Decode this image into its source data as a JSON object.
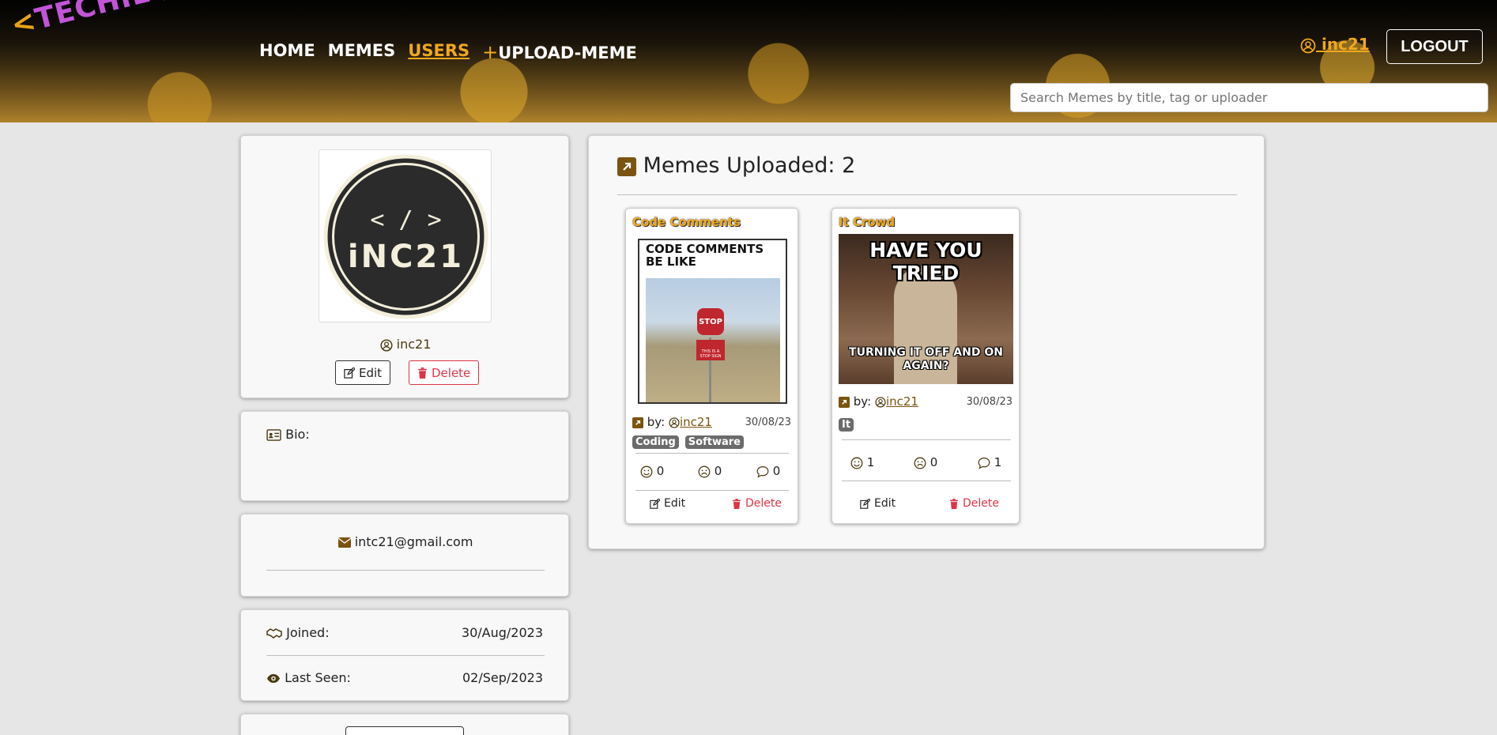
{
  "header": {
    "logo": {
      "bracket_open": "<",
      "text": "TECHIE / MEME",
      "bracket_close": ">"
    },
    "nav": [
      {
        "label": "HOME"
      },
      {
        "label": "MEMES"
      },
      {
        "label": "USERS"
      },
      {
        "plus": "+",
        "label": "UPLOAD-MEME"
      }
    ],
    "user_link": "inc21",
    "logout_label": "LOGOUT",
    "search_placeholder": "Search Memes by title, tag or uploader"
  },
  "profile": {
    "avatar_text": {
      "symbol": "< / >",
      "name": "iNC21"
    },
    "username": "inc21",
    "edit_label": "Edit",
    "delete_label": "Delete",
    "bio_label": "Bio:",
    "bio_text": "",
    "email": "intc21@gmail.com",
    "joined_label": "Joined:",
    "joined_value": "30/Aug/2023",
    "last_seen_label": "Last Seen:",
    "last_seen_value": "02/Sep/2023"
  },
  "memes_panel": {
    "heading": "Memes Uploaded: 2",
    "memes": [
      {
        "title": "Code Comments",
        "image_top": "CODE COMMENTS BE LIKE",
        "image_sign": "STOP",
        "image_sign2": "THIS IS A STOP SIGN",
        "by_label": "by:",
        "uploader": "inc21",
        "date": "30/08/23",
        "tags": [
          "Coding",
          "Software"
        ],
        "likes": "0",
        "dislikes": "0",
        "comments": "0",
        "edit_label": "Edit",
        "delete_label": "Delete"
      },
      {
        "title": "It Crowd",
        "image_top": "HAVE YOU TRIED",
        "image_bottom": "TURNING IT OFF AND ON AGAIN?",
        "by_label": "by:",
        "uploader": "inc21",
        "date": "30/08/23",
        "tags": [
          "It"
        ],
        "likes": "1",
        "dislikes": "0",
        "comments": "1",
        "edit_label": "Edit",
        "delete_label": "Delete"
      }
    ]
  },
  "colors": {
    "accent": "#f0a81c",
    "brand_purple": "#c254d8",
    "danger": "#dc3545",
    "icon_brown": "#7a5410"
  }
}
